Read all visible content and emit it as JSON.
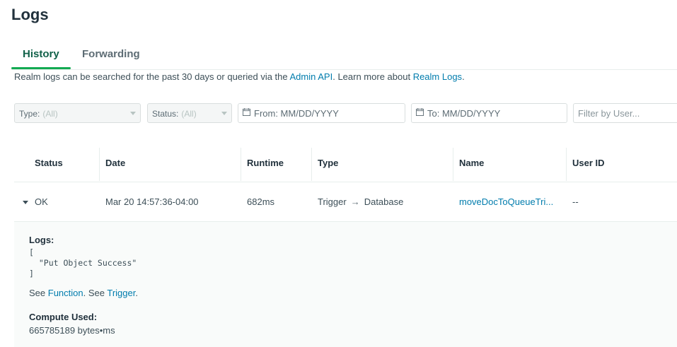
{
  "page": {
    "title": "Logs"
  },
  "tabs": [
    {
      "label": "History",
      "active": true
    },
    {
      "label": "Forwarding",
      "active": false
    }
  ],
  "info": {
    "prefix": "Realm logs can be searched for the past 30 days or queried via the ",
    "admin_api": "Admin API",
    "middle": ". Learn more about ",
    "realm_logs": "Realm Logs",
    "suffix": "."
  },
  "filters": {
    "type": {
      "label": "Type:",
      "value": "(All)"
    },
    "status": {
      "label": "Status:",
      "value": "(All)"
    },
    "from_placeholder": "From: MM/DD/YYYY",
    "to_placeholder": "To: MM/DD/YYYY",
    "user_placeholder": "Filter by User..."
  },
  "table": {
    "headers": [
      "Status",
      "Date",
      "Runtime",
      "Type",
      "Name",
      "User ID"
    ],
    "rows": [
      {
        "status": "OK",
        "date": "Mar 20 14:57:36-04:00",
        "runtime": "682ms",
        "type_from": "Trigger",
        "type_arrow": "→",
        "type_to": "Database",
        "name": "moveDocToQueueTri...",
        "user_id": "--"
      }
    ]
  },
  "detail": {
    "logs_label": "Logs:",
    "logs_lines": [
      "[",
      "  \"Put Object Success\"",
      "]"
    ],
    "see_prefix": "See ",
    "function_link": "Function",
    "see_middle": ". See ",
    "trigger_link": "Trigger",
    "see_suffix": ".",
    "compute_label": "Compute Used:",
    "compute_value": "665785189 bytes•ms"
  },
  "colors": {
    "accent": "#13aa52",
    "link": "#007cad",
    "tab_active": "#116149"
  }
}
